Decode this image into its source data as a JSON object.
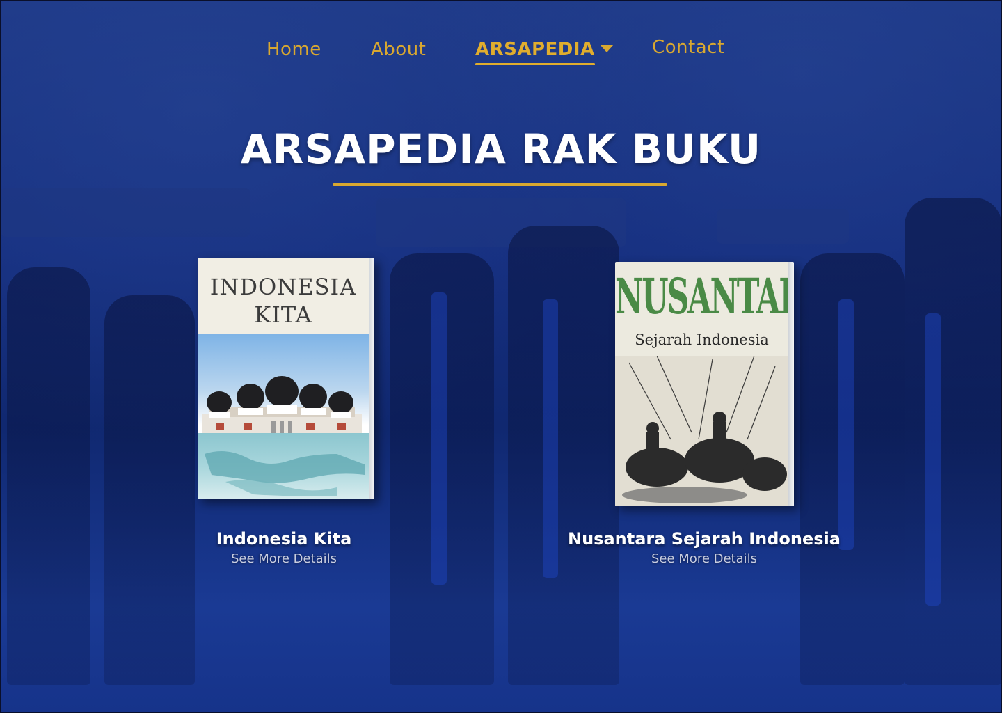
{
  "colors": {
    "background": "#142a7a",
    "accent": "#d9a830",
    "title": "#ffffff",
    "link": "#c8cde0"
  },
  "nav": {
    "items": [
      {
        "label": "Home"
      },
      {
        "label": "About"
      },
      {
        "label": "ARSAPEDIA",
        "active": true,
        "has_dropdown": true
      },
      {
        "label": "Contact"
      }
    ]
  },
  "page": {
    "title": "ARSAPEDIA RAK BUKU"
  },
  "books": [
    {
      "name": "Indonesia Kita",
      "link": "See More Details",
      "cover_title_line1": "INDONESIA",
      "cover_title_line2": "KITA"
    },
    {
      "name": "Nusantara Sejarah Indonesia",
      "link": "See More Details",
      "cover_title": "NUSANTARA",
      "cover_subtitle": "Sejarah Indonesia"
    }
  ],
  "icons": {
    "dropdown": "chevron-down-icon"
  }
}
